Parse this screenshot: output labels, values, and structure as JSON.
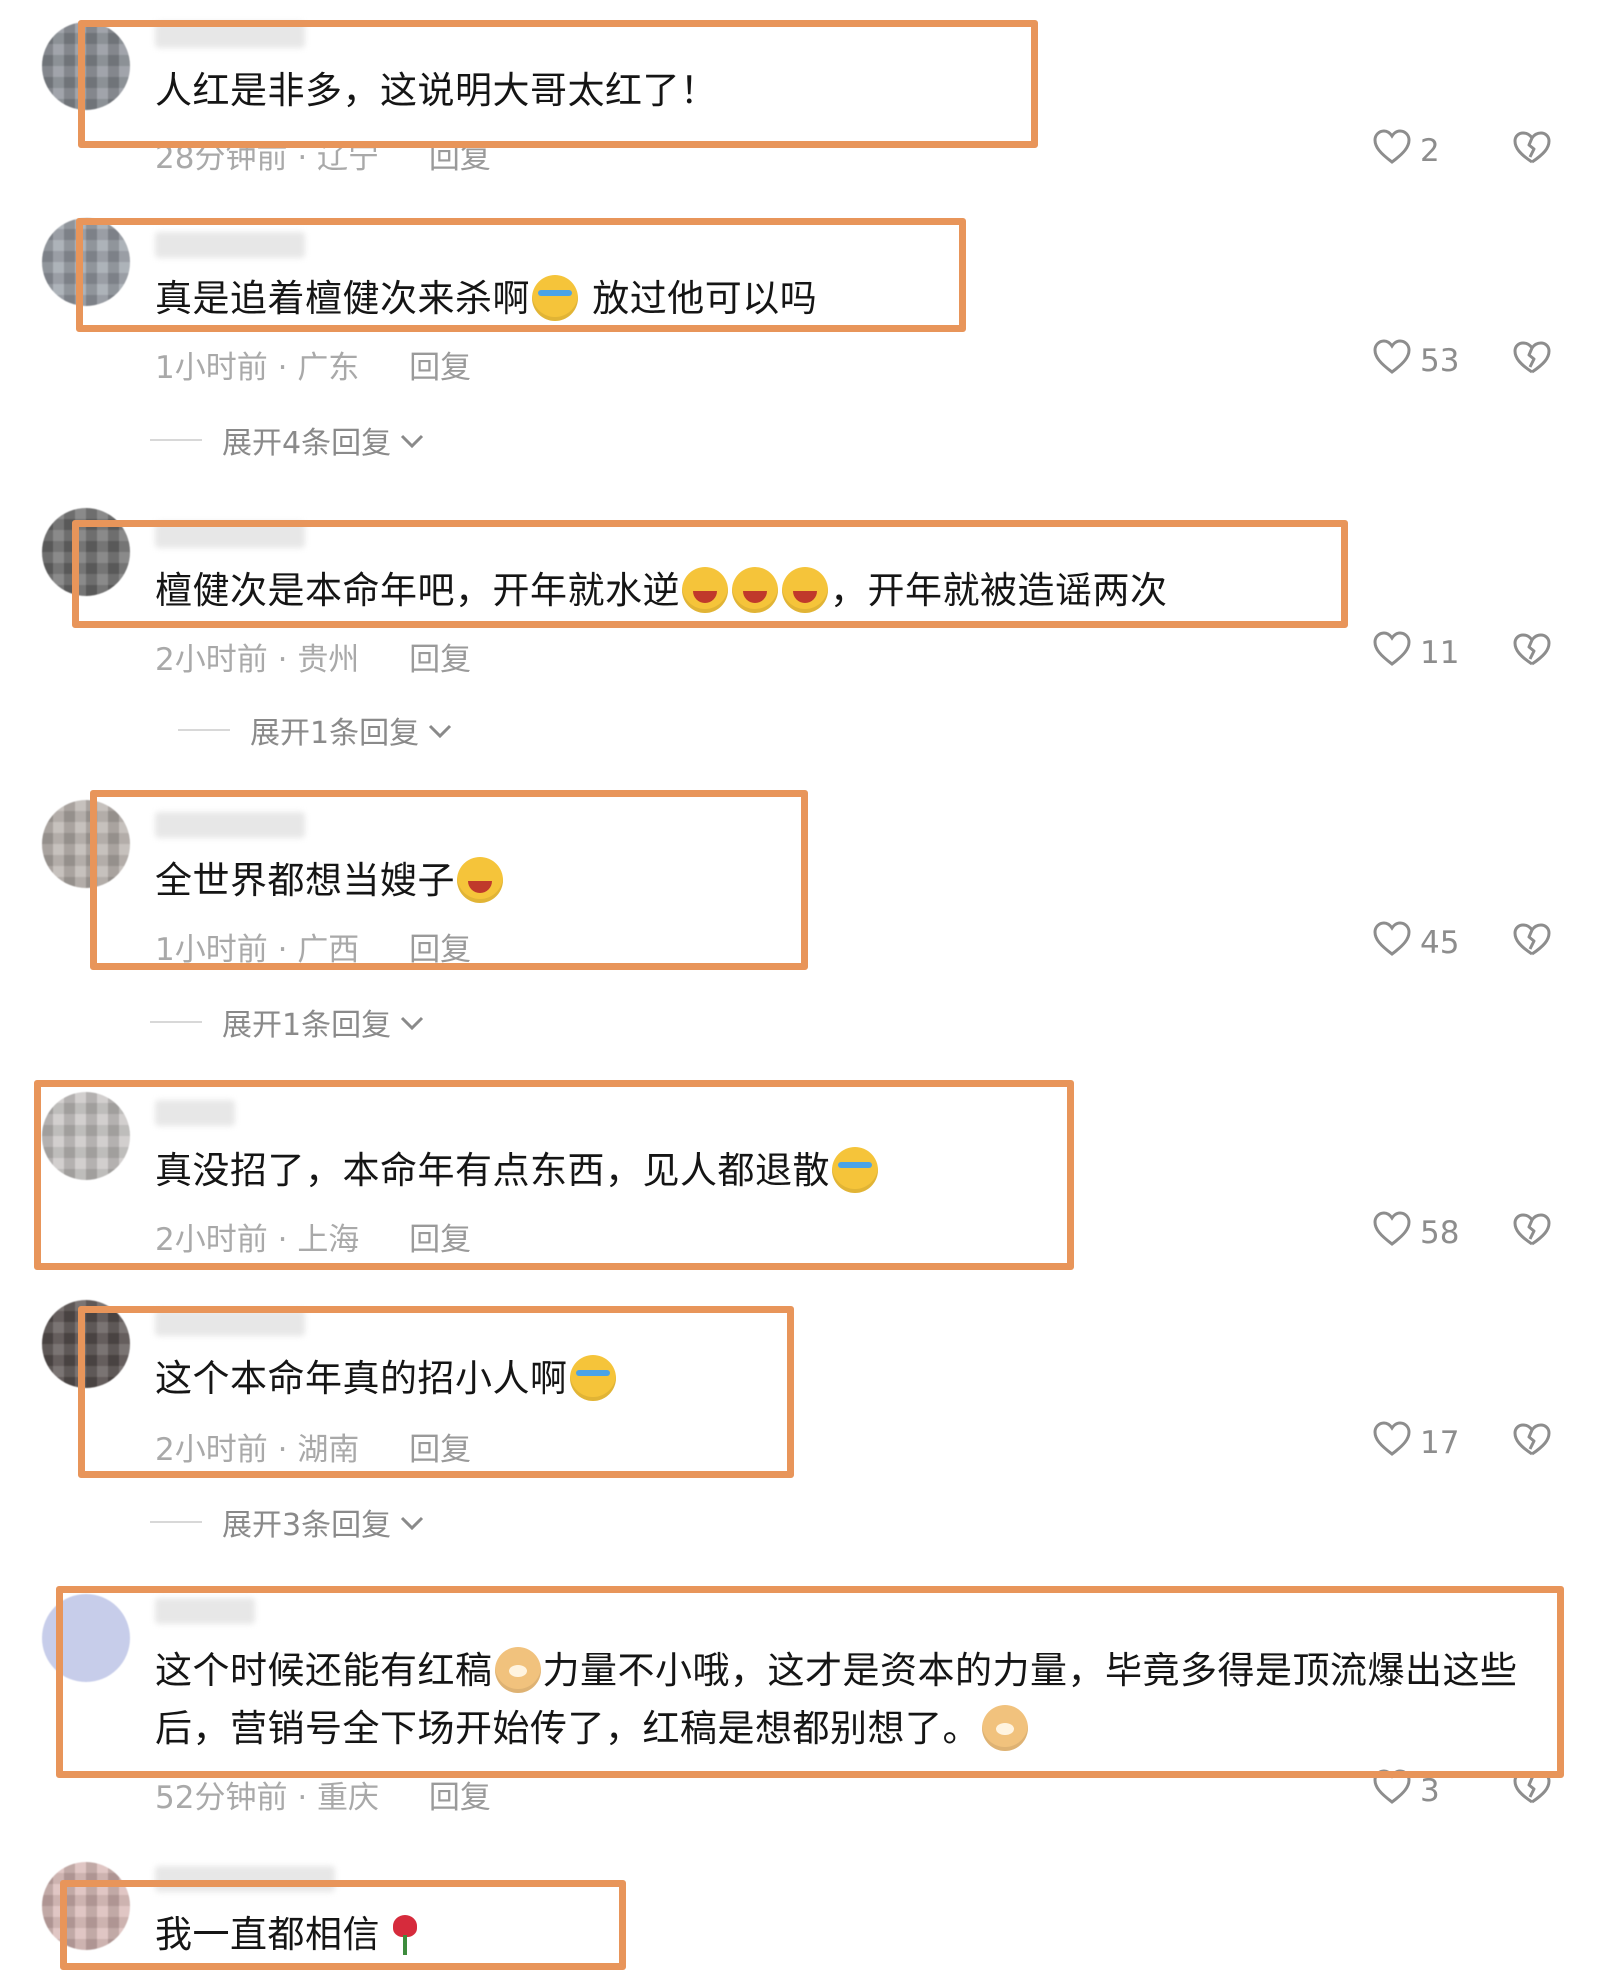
{
  "comments": [
    {
      "text": "人红是非多，这说明大哥太红了！",
      "time": "28分钟前",
      "location": "辽宁",
      "reply": "回复",
      "likes": "2",
      "expand": ""
    },
    {
      "text_a": "真是追着檀健次来杀啊",
      "text_b": "放过他可以吗",
      "time": "1小时前",
      "location": "广东",
      "reply": "回复",
      "likes": "53",
      "expand": "展开4条回复"
    },
    {
      "text_a": "檀健次是本命年吧，开年就水逆",
      "text_b": "，开年就被造谣两次",
      "time": "2小时前",
      "location": "贵州",
      "reply": "回复",
      "likes": "11",
      "expand": "展开1条回复"
    },
    {
      "text_a": "全世界都想当嫂子",
      "time": "1小时前",
      "location": "广西",
      "reply": "回复",
      "likes": "45",
      "expand": "展开1条回复"
    },
    {
      "text_a": "真没招了，本命年有点东西，见人都退散",
      "time": "2小时前",
      "location": "上海",
      "reply": "回复",
      "likes": "58",
      "expand": ""
    },
    {
      "text_a": "这个本命年真的招小人啊",
      "time": "2小时前",
      "location": "湖南",
      "reply": "回复",
      "likes": "17",
      "expand": "展开3条回复"
    },
    {
      "line1_a": "这个时候还能有红稿",
      "line1_b": "力量不小哦，这才是资本的力量，毕竟多得是顶流爆出这些",
      "line2": "后，营销号全下场开始传了，红稿是想都别想了。",
      "time": "52分钟前",
      "location": "重庆",
      "reply": "回复",
      "likes": "3",
      "expand": ""
    },
    {
      "text_a": "我一直都相信"
    }
  ],
  "separator": "·",
  "colors": {
    "highlight": "#e8955a",
    "text": "#151515",
    "meta": "#a9a9a9"
  },
  "icons": {
    "like": "heart-outline-icon",
    "dislike": "broken-heart-icon",
    "expand": "chevron-down-icon"
  }
}
